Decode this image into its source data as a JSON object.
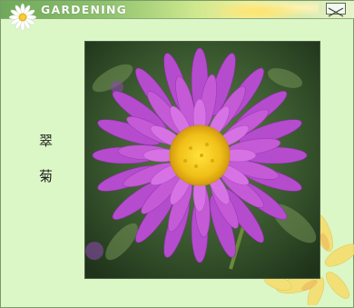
{
  "window": {
    "title": "GARDENING",
    "close_icon": "close-x-icon",
    "logo_icon": "daisy-icon"
  },
  "content": {
    "flower_name": "翠菊",
    "photo": "purple-aster-flower-image"
  },
  "colors": {
    "background": "#dcf7c6",
    "titlebar_start": "#6fa85a",
    "titlebar_end": "#e8f3cc",
    "petal": "#c45ad6",
    "center": "#f2c81e"
  }
}
